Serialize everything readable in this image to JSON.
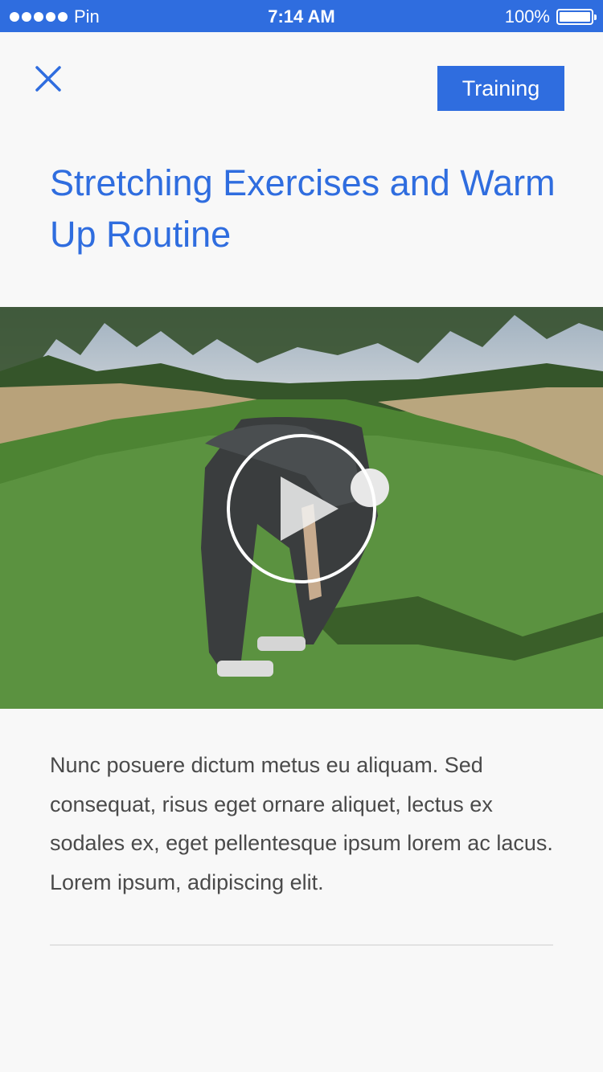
{
  "status_bar": {
    "carrier": "Pin",
    "time": "7:14 AM",
    "battery": "100%"
  },
  "header": {
    "close_icon": "close-icon",
    "tag_label": "Training"
  },
  "article": {
    "title": "Stretching Exercises and Warm Up Routine",
    "video": {
      "play_icon": "play-icon"
    },
    "description": "Nunc posuere dictum metus eu aliquam. Sed consequat, risus eget ornare aliquet, lectus ex sodales ex, eget pellentesque ipsum lorem ac lacus. Lorem ipsum, adipiscing elit."
  },
  "colors": {
    "accent": "#2f6ddf",
    "text": "#4a4a4a",
    "background": "#f8f8f8"
  }
}
